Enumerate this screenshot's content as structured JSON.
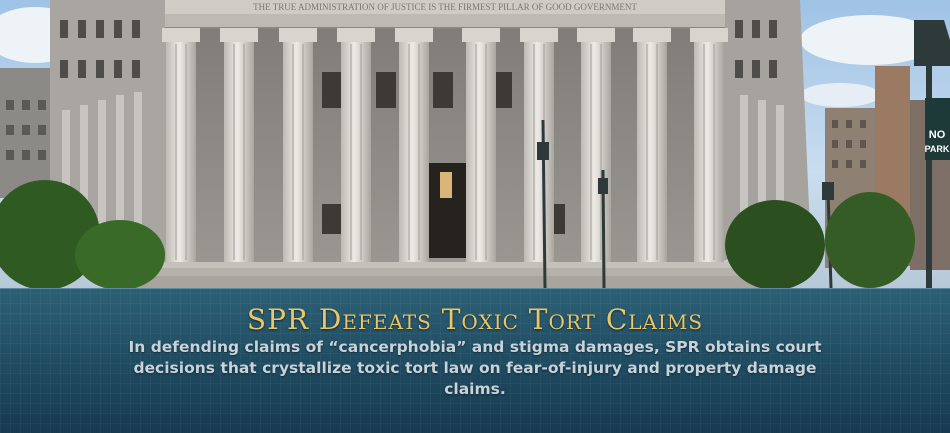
{
  "hero": {
    "image_alt": "Courthouse building with tall columns",
    "pediment_inscription": "THE TRUE ADMINISTRATION OF JUSTICE IS THE FIRMEST PILLAR OF GOOD GOVERNMENT",
    "sign_no": "NO",
    "sign_park": "PARK"
  },
  "caption": {
    "headline": "SPR Defeats Toxic Tort Claims",
    "body": "In defending claims of “cancerphobia” and stigma damages, SPR obtains court decisions that crystallize toxic tort law on fear-of-injury and property damage claims."
  },
  "colors": {
    "headline": "#e8c66a",
    "body_text": "#c7d3da",
    "panel": "#1f4a60"
  }
}
